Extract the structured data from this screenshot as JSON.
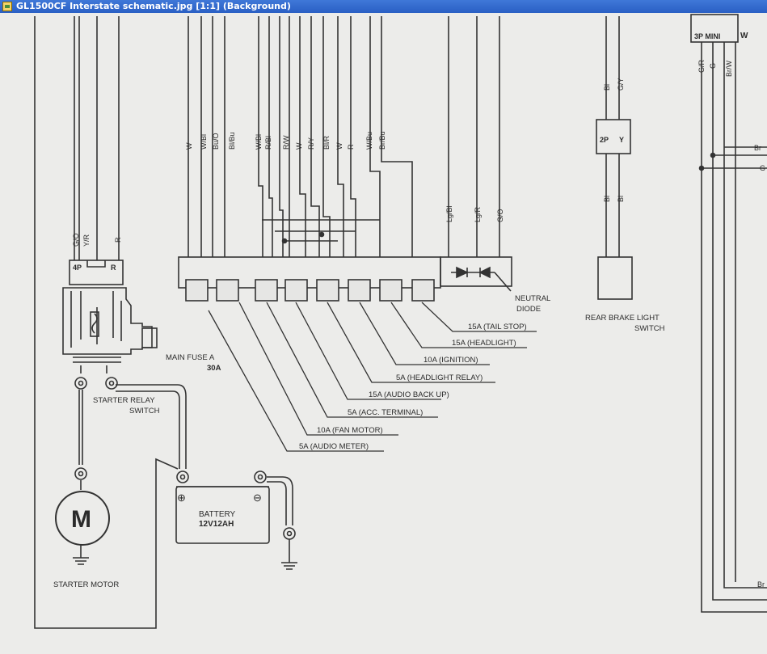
{
  "window": {
    "title": "GL1500CF Interstate schematic.jpg [1:1] (Background)"
  },
  "connectors": {
    "c4p": "4P",
    "c4p_pin": "R",
    "c2p": "2P",
    "c2p_pin": "Y",
    "c3p": "3P MINI",
    "c3p_pin": "W"
  },
  "wires": {
    "relay": [
      "G/O",
      "Y/R",
      "R"
    ],
    "fuse_top": [
      "W",
      "W/Bl",
      "Bu/O",
      "Bl/Bu",
      "W/Bl",
      "R/Bl",
      "R/W",
      "W",
      "R/Y",
      "Bl/R",
      "W",
      "R",
      "W/Bu",
      "Br/Bu"
    ],
    "diode": [
      "Lg/Bl",
      "Lg/R",
      "G/O"
    ],
    "brake": [
      "Bl",
      "G/Y"
    ],
    "brake_lower": [
      "Bl",
      "Bl"
    ],
    "right": [
      "G/R",
      "G",
      "Br/W"
    ],
    "right_branch": [
      "Br",
      "G",
      "Br"
    ]
  },
  "fuses": [
    "15A (TAIL STOP)",
    "15A (HEADLIGHT)",
    "10A (IGNITION)",
    "5A (HEADLIGHT RELAY)",
    "15A (AUDIO BACK UP)",
    "5A (ACC. TERMINAL)",
    "10A (FAN MOTOR)",
    "5A (AUDIO METER)"
  ],
  "labels": {
    "neutral_1": "NEUTRAL",
    "neutral_2": "DIODE",
    "brake_1": "REAR BRAKE LIGHT",
    "brake_2": "SWITCH",
    "main_fuse_1": "MAIN FUSE A",
    "main_fuse_2": "30A",
    "relay_1": "STARTER RELAY",
    "relay_2": "SWITCH",
    "battery_1": "BATTERY",
    "battery_2": "12V12AH",
    "battery_plus": "⊕",
    "battery_minus": "⊖",
    "motor_letter": "M",
    "motor_label": "STARTER MOTOR"
  }
}
